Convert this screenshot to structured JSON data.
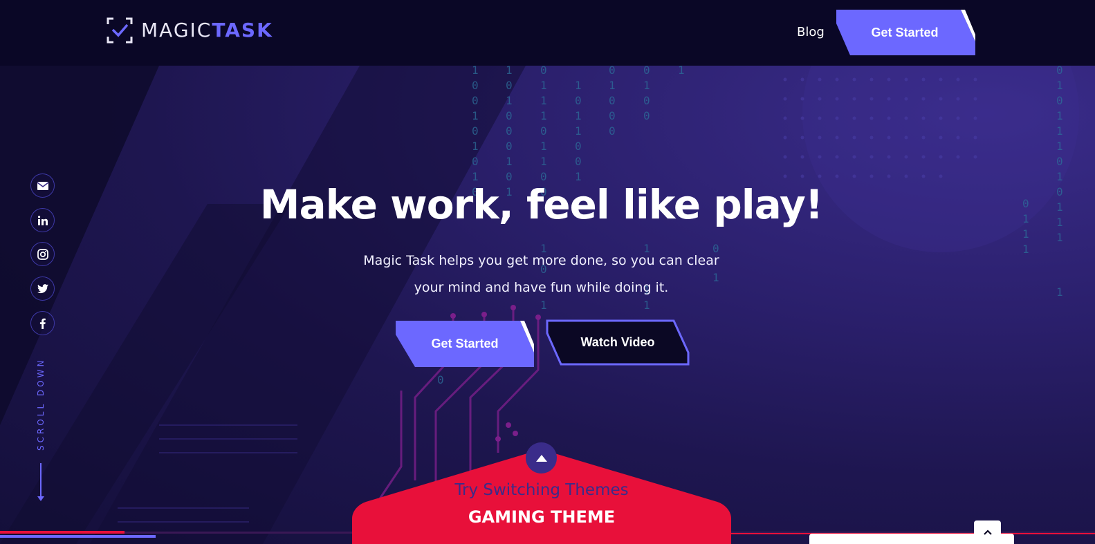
{
  "brand": {
    "name_light": "MAGIC",
    "name_bold": "TASK"
  },
  "nav": {
    "blog_label": "Blog",
    "cta_label": "Get Started"
  },
  "hero": {
    "title": "Make work, feel like play!",
    "subtitle": "Magic Task helps you get more done, so you can clear your mind and have fun while doing it.",
    "primary_button": "Get Started",
    "secondary_button": "Watch Video"
  },
  "social": [
    {
      "name": "email-icon"
    },
    {
      "name": "linkedin-icon"
    },
    {
      "name": "instagram-icon"
    },
    {
      "name": "twitter-icon"
    },
    {
      "name": "facebook-icon"
    }
  ],
  "scroll": {
    "label": "SCROLL DOWN"
  },
  "theme_switcher": {
    "prompt": "Try Switching Themes",
    "theme_name": "GAMING THEME"
  },
  "colors": {
    "accent": "#6c68ff",
    "header_bg": "#0a0726",
    "theme_panel": "#e8103a",
    "hero_purple": "#2a1f6b"
  }
}
